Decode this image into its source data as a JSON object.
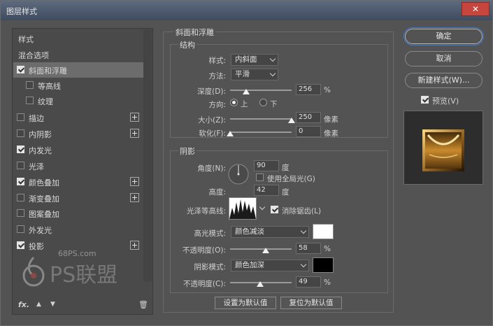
{
  "window": {
    "title": "图层样式",
    "close_symbol": "✕"
  },
  "left_panel": {
    "items": [
      {
        "label": "样式",
        "has_checkbox": false,
        "checked": false,
        "has_plus": false,
        "selected": false,
        "indent": 0
      },
      {
        "label": "混合选项",
        "has_checkbox": false,
        "checked": false,
        "has_plus": false,
        "selected": false,
        "indent": 0
      },
      {
        "label": "斜面和浮雕",
        "has_checkbox": true,
        "checked": true,
        "has_plus": false,
        "selected": true,
        "indent": 0
      },
      {
        "label": "等高线",
        "has_checkbox": true,
        "checked": false,
        "has_plus": false,
        "selected": false,
        "indent": 1
      },
      {
        "label": "纹理",
        "has_checkbox": true,
        "checked": false,
        "has_plus": false,
        "selected": false,
        "indent": 1
      },
      {
        "label": "描边",
        "has_checkbox": true,
        "checked": false,
        "has_plus": true,
        "selected": false,
        "indent": 0
      },
      {
        "label": "内阴影",
        "has_checkbox": true,
        "checked": false,
        "has_plus": true,
        "selected": false,
        "indent": 0
      },
      {
        "label": "内发光",
        "has_checkbox": true,
        "checked": true,
        "has_plus": false,
        "selected": false,
        "indent": 0
      },
      {
        "label": "光泽",
        "has_checkbox": true,
        "checked": false,
        "has_plus": false,
        "selected": false,
        "indent": 0
      },
      {
        "label": "颜色叠加",
        "has_checkbox": true,
        "checked": true,
        "has_plus": true,
        "selected": false,
        "indent": 0
      },
      {
        "label": "渐变叠加",
        "has_checkbox": true,
        "checked": false,
        "has_plus": true,
        "selected": false,
        "indent": 0
      },
      {
        "label": "图案叠加",
        "has_checkbox": true,
        "checked": false,
        "has_plus": false,
        "selected": false,
        "indent": 0
      },
      {
        "label": "外发光",
        "has_checkbox": true,
        "checked": false,
        "has_plus": false,
        "selected": false,
        "indent": 0
      },
      {
        "label": "投影",
        "has_checkbox": true,
        "checked": true,
        "has_plus": true,
        "selected": false,
        "indent": 0
      }
    ],
    "fx_label": "fx",
    "fx_suffix": ".",
    "up_icon": "▲",
    "down_icon": "▼",
    "trash_icon": "🗑",
    "watermark_domain": "68PS.com",
    "watermark_text": "PS联盟"
  },
  "bevel_emboss": {
    "section_title": "斜面和浮雕",
    "structure": {
      "title": "结构",
      "style_label": "样式:",
      "style_value": "内斜面",
      "technique_label": "方法:",
      "technique_value": "平滑",
      "depth_label": "深度(D):",
      "depth_value": "256",
      "depth_unit": "%",
      "depth_fraction": 0.26,
      "direction_label": "方向:",
      "direction_up": "上",
      "direction_down": "下",
      "direction_selected": "上",
      "size_label": "大小(Z):",
      "size_value": "250",
      "size_unit": "像素",
      "size_fraction": 1.0,
      "soften_label": "软化(F):",
      "soften_value": "0",
      "soften_unit": "像素",
      "soften_fraction": 0.0
    },
    "shading": {
      "title": "阴影",
      "angle_label": "角度(N):",
      "angle_value": "90",
      "angle_unit": "度",
      "global_light_label": "使用全局光(G)",
      "global_light_checked": false,
      "altitude_label": "高度:",
      "altitude_value": "42",
      "altitude_unit": "度",
      "gloss_contour_label": "光泽等高线:",
      "anti_alias_label": "消除锯齿(L)",
      "anti_alias_checked": true,
      "highlight_mode_label": "高光模式:",
      "highlight_mode_value": "颜色减淡",
      "highlight_color": "#ffffff",
      "highlight_opacity_label": "不透明度(O):",
      "highlight_opacity_value": "58",
      "highlight_opacity_unit": "%",
      "highlight_opacity_fraction": 0.58,
      "shadow_mode_label": "阴影模式:",
      "shadow_mode_value": "颜色加深",
      "shadow_color": "#000000",
      "shadow_opacity_label": "不透明度(C):",
      "shadow_opacity_value": "49",
      "shadow_opacity_unit": "%",
      "shadow_opacity_fraction": 0.49
    },
    "make_default": "设置为默认值",
    "reset_default": "复位为默认值"
  },
  "right_panel": {
    "ok": "确定",
    "cancel": "取消",
    "new_style": "新建样式(W)...",
    "preview_label": "预览(V)",
    "preview_checked": true
  },
  "colors": {
    "accent": "#3a7bd5",
    "gold": "#c98a2c"
  }
}
